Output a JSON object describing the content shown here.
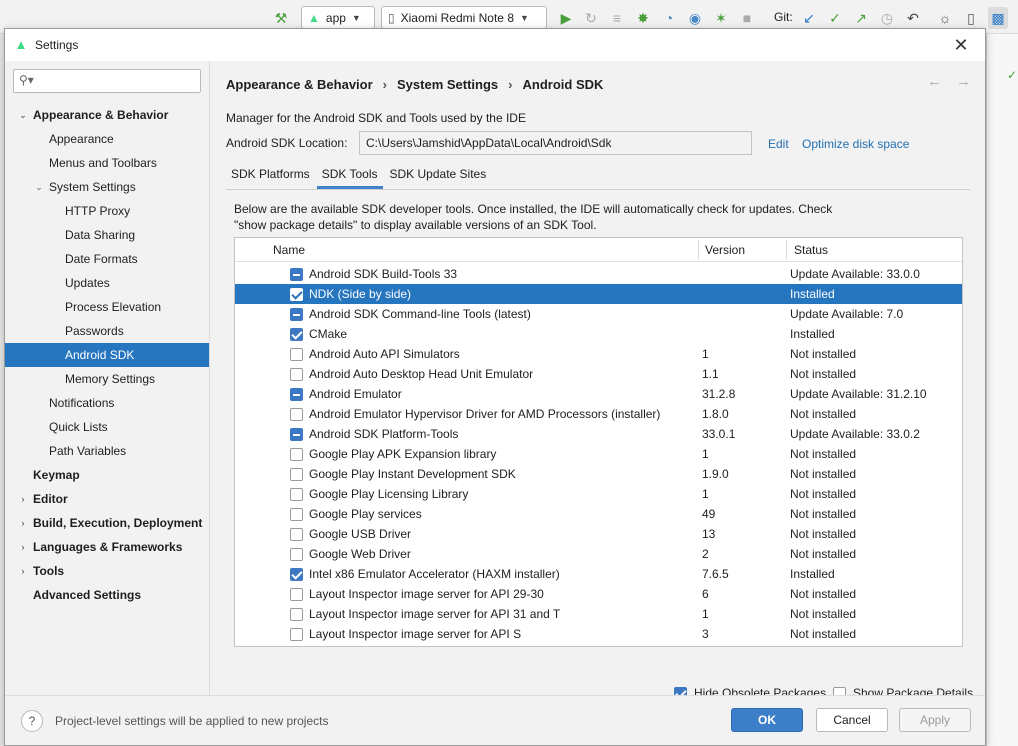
{
  "toolbar": {
    "run_config": "app",
    "device": "Xiaomi Redmi Note 8",
    "git_label": "Git:"
  },
  "dialog": {
    "title": "Settings",
    "search_placeholder": ""
  },
  "sidebar": {
    "items": [
      {
        "label": "Appearance & Behavior",
        "level": 0,
        "bold": true,
        "expanded": true
      },
      {
        "label": "Appearance",
        "level": 1
      },
      {
        "label": "Menus and Toolbars",
        "level": 1
      },
      {
        "label": "System Settings",
        "level": 1,
        "expanded": true
      },
      {
        "label": "HTTP Proxy",
        "level": 2
      },
      {
        "label": "Data Sharing",
        "level": 2
      },
      {
        "label": "Date Formats",
        "level": 2
      },
      {
        "label": "Updates",
        "level": 2
      },
      {
        "label": "Process Elevation",
        "level": 2
      },
      {
        "label": "Passwords",
        "level": 2
      },
      {
        "label": "Android SDK",
        "level": 2,
        "selected": true
      },
      {
        "label": "Memory Settings",
        "level": 2
      },
      {
        "label": "Notifications",
        "level": 1
      },
      {
        "label": "Quick Lists",
        "level": 1
      },
      {
        "label": "Path Variables",
        "level": 1
      },
      {
        "label": "Keymap",
        "level": 0,
        "bold": true
      },
      {
        "label": "Editor",
        "level": 0,
        "bold": true,
        "collapsed": true
      },
      {
        "label": "Build, Execution, Deployment",
        "level": 0,
        "bold": true,
        "collapsed": true
      },
      {
        "label": "Languages & Frameworks",
        "level": 0,
        "bold": true,
        "collapsed": true
      },
      {
        "label": "Tools",
        "level": 0,
        "bold": true,
        "collapsed": true
      },
      {
        "label": "Advanced Settings",
        "level": 0,
        "bold": true
      }
    ]
  },
  "content": {
    "breadcrumb": [
      "Appearance & Behavior",
      "System Settings",
      "Android SDK"
    ],
    "description": "Manager for the Android SDK and Tools used by the IDE",
    "location_label": "Android SDK Location:",
    "location_value": "C:\\Users\\Jamshid\\AppData\\Local\\Android\\Sdk",
    "edit_link": "Edit",
    "optimize_link": "Optimize disk space",
    "tabs": [
      "SDK Platforms",
      "SDK Tools",
      "SDK Update Sites"
    ],
    "active_tab": "SDK Tools",
    "panel_text_line1": "Below are the available SDK developer tools. Once installed, the IDE will automatically check for updates. Check",
    "panel_text_line2": "\"show package details\" to display available versions of an SDK Tool.",
    "columns": {
      "name": "Name",
      "version": "Version",
      "status": "Status"
    },
    "rows": [
      {
        "check": "partial",
        "name": "Android SDK Build-Tools 33",
        "version": "",
        "status": "Update Available: 33.0.0"
      },
      {
        "check": "checked",
        "name": "NDK (Side by side)",
        "version": "",
        "status": "Installed",
        "selected": true
      },
      {
        "check": "partial",
        "name": "Android SDK Command-line Tools (latest)",
        "version": "",
        "status": "Update Available: 7.0"
      },
      {
        "check": "checked",
        "name": "CMake",
        "version": "",
        "status": "Installed"
      },
      {
        "check": "none",
        "name": "Android Auto API Simulators",
        "version": "1",
        "status": "Not installed"
      },
      {
        "check": "none",
        "name": "Android Auto Desktop Head Unit Emulator",
        "version": "1.1",
        "status": "Not installed"
      },
      {
        "check": "partial",
        "name": "Android Emulator",
        "version": "31.2.8",
        "status": "Update Available: 31.2.10"
      },
      {
        "check": "none",
        "name": "Android Emulator Hypervisor Driver for AMD Processors (installer)",
        "version": "1.8.0",
        "status": "Not installed"
      },
      {
        "check": "partial",
        "name": "Android SDK Platform-Tools",
        "version": "33.0.1",
        "status": "Update Available: 33.0.2"
      },
      {
        "check": "none",
        "name": "Google Play APK Expansion library",
        "version": "1",
        "status": "Not installed"
      },
      {
        "check": "none",
        "name": "Google Play Instant Development SDK",
        "version": "1.9.0",
        "status": "Not installed"
      },
      {
        "check": "none",
        "name": "Google Play Licensing Library",
        "version": "1",
        "status": "Not installed"
      },
      {
        "check": "none",
        "name": "Google Play services",
        "version": "49",
        "status": "Not installed"
      },
      {
        "check": "none",
        "name": "Google USB Driver",
        "version": "13",
        "status": "Not installed"
      },
      {
        "check": "none",
        "name": "Google Web Driver",
        "version": "2",
        "status": "Not installed"
      },
      {
        "check": "checked",
        "name": "Intel x86 Emulator Accelerator (HAXM installer)",
        "version": "7.6.5",
        "status": "Installed"
      },
      {
        "check": "none",
        "name": "Layout Inspector image server for API 29-30",
        "version": "6",
        "status": "Not installed"
      },
      {
        "check": "none",
        "name": "Layout Inspector image server for API 31 and T",
        "version": "1",
        "status": "Not installed"
      },
      {
        "check": "none",
        "name": "Layout Inspector image server for API S",
        "version": "3",
        "status": "Not installed"
      }
    ],
    "hide_obsolete_label": "Hide Obsolete Packages",
    "hide_obsolete_checked": true,
    "show_details_label": "Show Package Details",
    "show_details_checked": false
  },
  "footer": {
    "help": "?",
    "text": "Project-level settings will be applied to new projects",
    "ok": "OK",
    "cancel": "Cancel",
    "apply": "Apply"
  },
  "colors": {
    "selection": "#2675bf",
    "accent": "#3c78c3",
    "link": "#2470b3"
  }
}
